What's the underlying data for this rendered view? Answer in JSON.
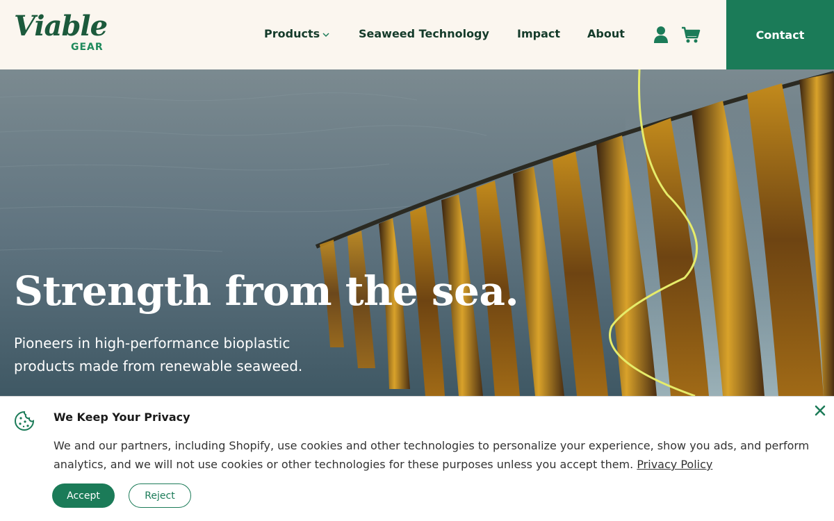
{
  "brand": {
    "logo_main": "Viable",
    "logo_sub": "GEAR"
  },
  "nav": {
    "items": [
      {
        "label": "Products",
        "has_dropdown": true
      },
      {
        "label": "Seaweed Technology"
      },
      {
        "label": "Impact"
      },
      {
        "label": "About"
      }
    ],
    "user_icon": "user-icon",
    "cart_icon": "cart-icon",
    "contact_label": "Contact"
  },
  "hero": {
    "title": "Strength from the sea.",
    "subtitle": "Pioneers in high-performance bioplastic products made from renewable seaweed."
  },
  "cookie": {
    "icon": "cookie-icon",
    "title": "We Keep Your Privacy",
    "text": "We and our partners, including Shopify, use cookies and other technologies to personalize your experience, show you ads, and perform analytics, and we will not use cookies or other technologies for these purposes unless you accept them. ",
    "link_label": "Privacy Policy",
    "accept_label": "Accept",
    "reject_label": "Reject",
    "close_icon": "close-icon"
  },
  "colors": {
    "brand_green": "#1b7b58",
    "dark_green": "#143b2a",
    "cream": "#fbf6ef"
  }
}
